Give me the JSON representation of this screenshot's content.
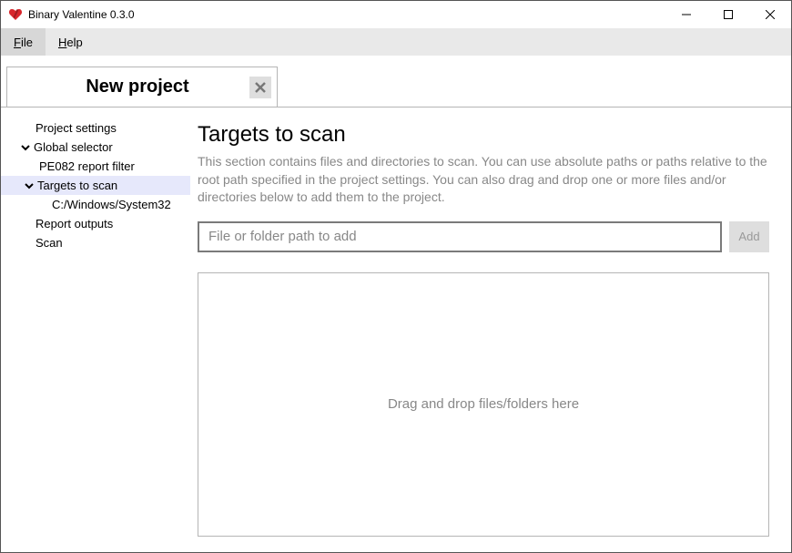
{
  "window": {
    "title": "Binary Valentine 0.3.0"
  },
  "menu": {
    "file": "File",
    "help": "Help"
  },
  "tab": {
    "title": "New project"
  },
  "sidebar": {
    "items": [
      {
        "label": "Project settings",
        "level": 0,
        "expandable": false
      },
      {
        "label": "Global selector",
        "level": 0,
        "expandable": true
      },
      {
        "label": "PE082 report filter",
        "level": 1,
        "expandable": false
      },
      {
        "label": "Targets to scan",
        "level": 1,
        "expandable": true,
        "selected": true
      },
      {
        "label": "C:/Windows/System32",
        "level": 2,
        "expandable": false
      },
      {
        "label": "Report outputs",
        "level": 0,
        "expandable": false
      },
      {
        "label": "Scan",
        "level": 0,
        "expandable": false
      }
    ]
  },
  "main": {
    "title": "Targets to scan",
    "description": "This section contains files and directories to scan. You can use absolute paths or paths relative to the root path specified in the project settings. You can also drag and drop one or more files and/or directories below to add them to the project.",
    "input_placeholder": "File or folder path to add",
    "add_label": "Add",
    "dropzone_text": "Drag and drop files/folders here"
  }
}
